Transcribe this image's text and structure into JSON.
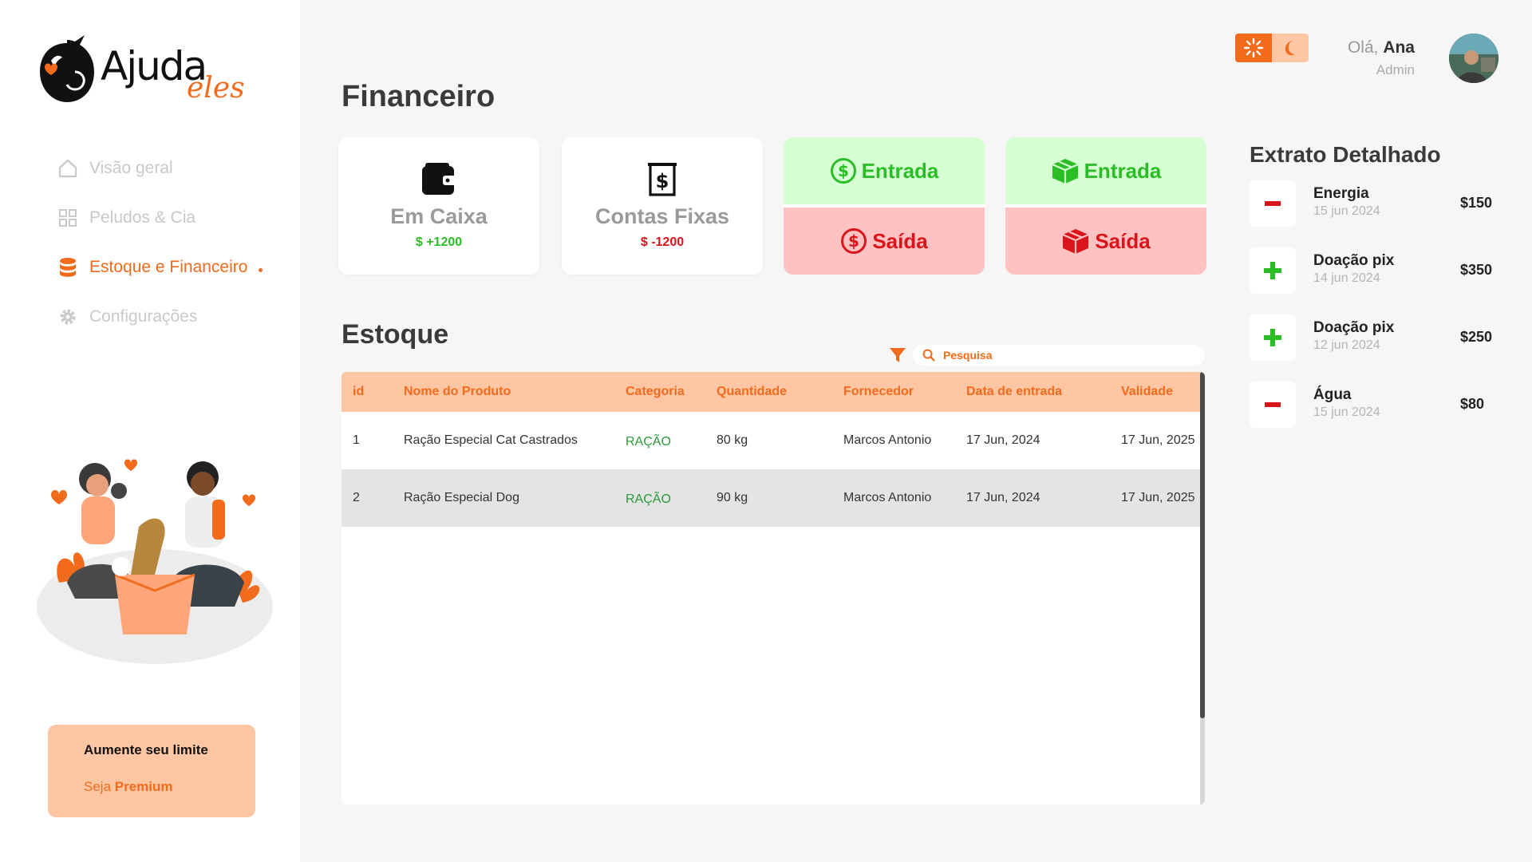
{
  "brand": {
    "word": "Ajuda",
    "script": "eles",
    "accent": "#f26a1b"
  },
  "sidebar": {
    "items": [
      {
        "label": "Visão geral",
        "icon": "home-icon",
        "active": false
      },
      {
        "label": "Peludos & Cia",
        "icon": "grid-icon",
        "active": false
      },
      {
        "label": "Estoque e Financeiro",
        "icon": "database-icon",
        "active": true
      },
      {
        "label": "Configurações",
        "icon": "gear-icon",
        "active": false
      }
    ],
    "premium": {
      "title": "Aumente seu limite",
      "sub_prefix": "Seja ",
      "sub_bold": "Premium"
    }
  },
  "header": {
    "hello_prefix": "Olá, ",
    "user_name": "Ana",
    "role": "Admin",
    "theme_light_icon": "sun-icon",
    "theme_dark_icon": "moon-icon"
  },
  "financeiro": {
    "title": "Financeiro",
    "em_caixa": {
      "label": "Em Caixa",
      "value": "$ +1200",
      "color": "#2bbd26"
    },
    "contas_fixas": {
      "label": "Contas Fixas",
      "value": "$ -1200",
      "color": "#d9141b"
    },
    "money_flow": {
      "in_label": "Entrada",
      "out_label": "Saída"
    },
    "stock_flow": {
      "in_label": "Entrada",
      "out_label": "Saída"
    }
  },
  "estoque": {
    "title": "Estoque",
    "search_placeholder": "Pesquisa",
    "columns": [
      "id",
      "Nome do Produto",
      "Categoria",
      "Quantidade",
      "Fornecedor",
      "Data de entrada",
      "Validade"
    ],
    "rows": [
      [
        "1",
        "Ração Especial Cat Castrados",
        "RAÇÃO",
        "80 kg",
        "Marcos Antonio",
        "17 Jun, 2024",
        "17 Jun, 2025"
      ],
      [
        "2",
        "Ração Especial Dog",
        "RAÇÃO",
        "90 kg",
        "Marcos Antonio",
        "17 Jun, 2024",
        "17 Jun, 2025"
      ]
    ]
  },
  "extrato": {
    "title": "Extrato Detalhado",
    "items": [
      {
        "name": "Energia",
        "date": "15 jun 2024",
        "amount": "$150",
        "type": "minus"
      },
      {
        "name": "Doação pix",
        "date": "14 jun 2024",
        "amount": "$350",
        "type": "plus"
      },
      {
        "name": "Doação pix",
        "date": "12 jun 2024",
        "amount": "$250",
        "type": "plus"
      },
      {
        "name": "Água",
        "date": "15 jun 2024",
        "amount": "$80",
        "type": "minus"
      }
    ]
  }
}
